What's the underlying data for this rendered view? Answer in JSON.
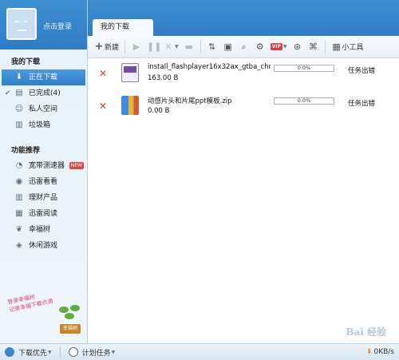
{
  "user": {
    "login_label": "点击登录"
  },
  "sidebar": {
    "my_downloads_title": "我的下载",
    "my_items": [
      {
        "label": "正在下载",
        "icon": "download-arrow-icon",
        "glyph": "⬇"
      },
      {
        "label": "已完成(4)",
        "icon": "done-icon",
        "glyph": "▤"
      },
      {
        "label": "私人空间",
        "icon": "user-icon",
        "glyph": "👤"
      },
      {
        "label": "垃圾箱",
        "icon": "trash-icon",
        "glyph": "🗑"
      }
    ],
    "features_title": "功能推荐",
    "feature_items": [
      {
        "label": "宽带测速器",
        "icon": "speed-gauge-icon",
        "glyph": "◔",
        "badge": "NEW"
      },
      {
        "label": "迅雷看看",
        "icon": "watch-icon",
        "glyph": "◉"
      },
      {
        "label": "理财产品",
        "icon": "finance-icon",
        "glyph": "▥"
      },
      {
        "label": "迅雷阅读",
        "icon": "book-icon",
        "glyph": "▦"
      },
      {
        "label": "幸福树",
        "icon": "leaf-icon",
        "glyph": "❦"
      },
      {
        "label": "休闲游戏",
        "icon": "gamepad-icon",
        "glyph": "◈"
      }
    ],
    "promo_line1": "登录幸福树",
    "promo_line2": "记录幸福下载点滴",
    "promo_pot_label": "幸福树"
  },
  "main": {
    "tab_label": "我的下载",
    "toolbar": {
      "new_label": "新建",
      "tools_label": "小工具",
      "vip_label": "VIP"
    },
    "downloads": [
      {
        "name": "install_flashplayer16x32ax_gtba_chra_...",
        "size": "163.00 B",
        "progress": "0.0%",
        "progress_fraction": 0.0,
        "status": "任务出错",
        "file_icon": "video-file-icon"
      },
      {
        "name": "动感片头和片尾ppt模板.zip",
        "size": "0.00 B",
        "progress": "0.0%",
        "progress_fraction": 0.0,
        "status": "任务出错",
        "file_icon": "zip-file-icon"
      }
    ],
    "watermark": "Bai 经验"
  },
  "statusbar": {
    "priority_label": "下载优先",
    "schedule_label": "计划任务",
    "speed": "0KB/s"
  },
  "colors": {
    "accent": "#2f7cc4",
    "error_x": "#d63b3b",
    "new_badge": "#e64545"
  }
}
